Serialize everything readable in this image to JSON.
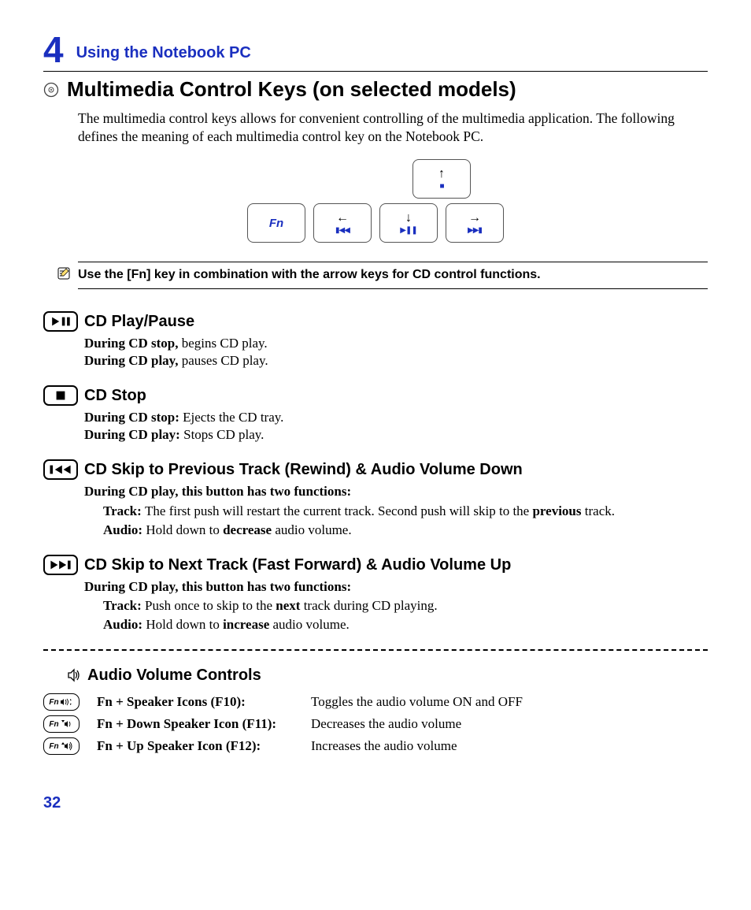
{
  "chapter": {
    "number": "4",
    "title": "Using the Notebook PC"
  },
  "main_heading": "Multimedia Control Keys (on selected models)",
  "intro": "The multimedia control keys allows for convenient controlling of the multimedia application. The following defines the meaning of each multimedia control key on the Notebook PC.",
  "keys": {
    "fn": "Fn",
    "up_media": "■",
    "left_media": "▮◀◀",
    "down_media": "▶❚❚",
    "right_media": "▶▶▮"
  },
  "note": "Use the [Fn] key in combination with the arrow keys for CD control functions.",
  "sections": {
    "play": {
      "title": "CD Play/Pause",
      "l1b": "During CD stop, ",
      "l1": "begins CD play.",
      "l2b": "During CD play, ",
      "l2": "pauses CD play."
    },
    "stop": {
      "title": "CD Stop",
      "l1b": "During CD stop: ",
      "l1": "Ejects the CD tray.",
      "l2b": "During CD play: ",
      "l2": "Stops CD play."
    },
    "prev": {
      "title": "CD Skip to Previous Track (Rewind) & Audio Volume Down",
      "sub": "During CD play, this button has two functions:",
      "trackb": "Track: ",
      "track1": "The first push will restart the current track. Second push will skip to the ",
      "track_em": "previous",
      "track2": " track.",
      "audiob": "Audio: ",
      "audio1": "Hold down to ",
      "audio_em": "decrease",
      "audio2": " audio volume."
    },
    "next": {
      "title": "CD Skip to Next Track (Fast Forward) & Audio Volume Up",
      "sub": "During CD play, this button has two functions:",
      "trackb": "Track: ",
      "track1": "Push once to skip to the ",
      "track_em": "next",
      "track2": " track during CD playing.",
      "audiob": "Audio: ",
      "audio1": "Hold down to ",
      "audio_em": "increase",
      "audio2": " audio volume."
    }
  },
  "audio": {
    "heading": "Audio Volume Controls",
    "rows": [
      {
        "label": "Fn + Speaker Icons (F10):",
        "desc": "Toggles the audio volume ON and OFF"
      },
      {
        "label": "Fn + Down Speaker Icon (F11):",
        "desc": "Decreases the audio volume"
      },
      {
        "label": "Fn + Up Speaker Icon (F12):",
        "desc": "Increases the audio volume"
      }
    ],
    "fn": "Fn"
  },
  "page_number": "32"
}
